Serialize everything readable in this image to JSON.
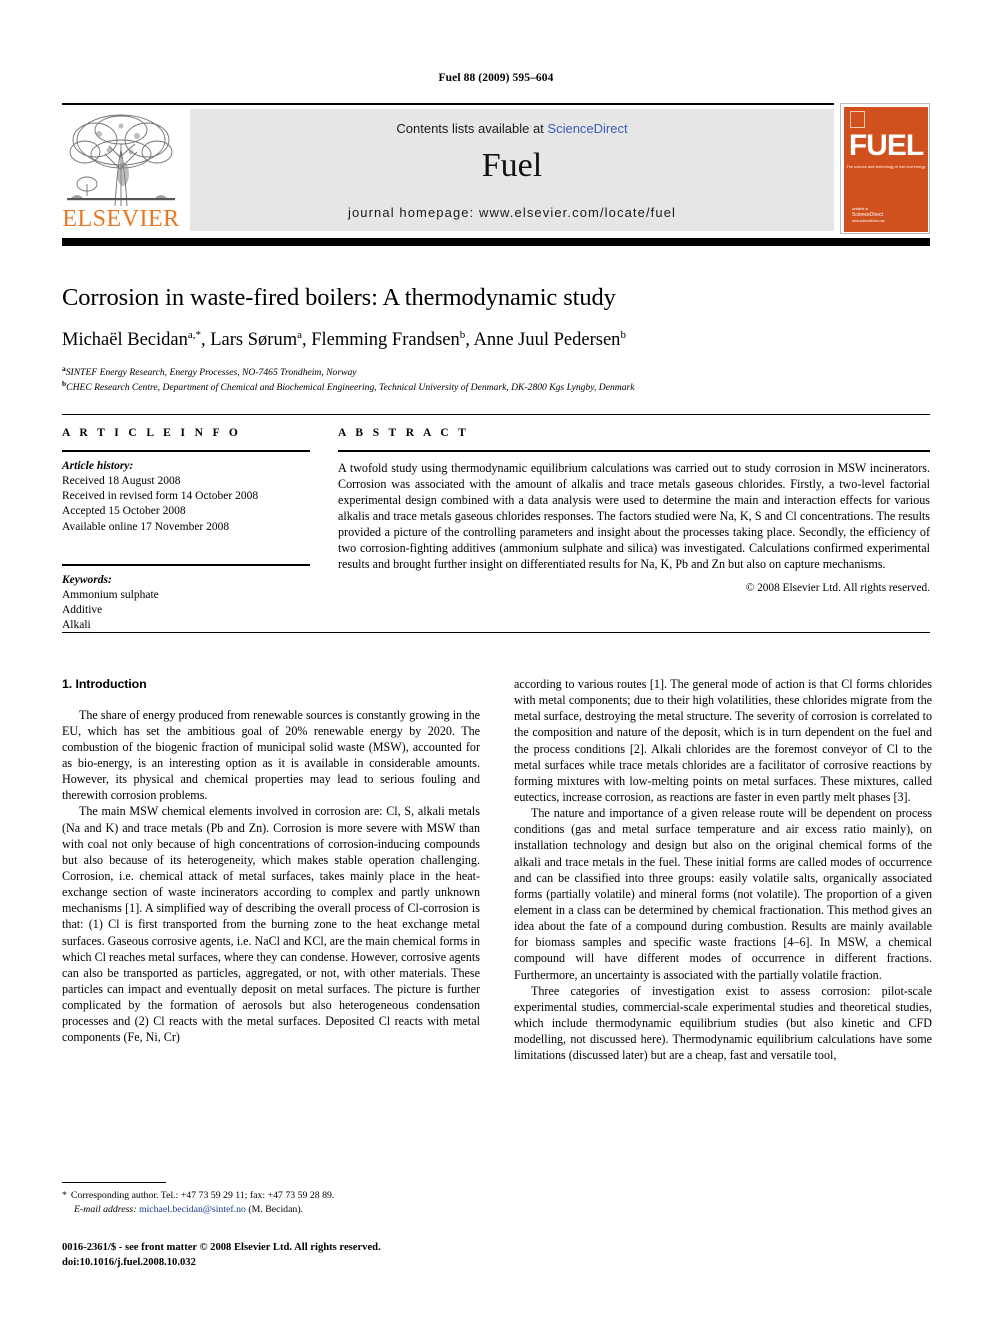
{
  "running_head": "Fuel 88 (2009) 595–604",
  "masthead": {
    "publisher": "ELSEVIER",
    "contents_prefix": "Contents lists available at ",
    "contents_link": "ScienceDirect",
    "journal_title": "Fuel",
    "homepage": "journal homepage: www.elsevier.com/locate/fuel",
    "cover": {
      "wordmark": "FUEL",
      "tagline": "The science and technology of fuel and energy",
      "sciencedirect_label": "available at",
      "sciencedirect_brand": "ScienceDirect",
      "sciencedirect_url": "www.sciencedirect.com"
    }
  },
  "article": {
    "title": "Corrosion in waste-fired boilers: A thermodynamic study",
    "authors": [
      {
        "name": "Michaël Becidan",
        "marks": "a,*"
      },
      {
        "name": "Lars Sørum",
        "marks": "a"
      },
      {
        "name": "Flemming Frandsen",
        "marks": "b"
      },
      {
        "name": "Anne Juul Pedersen",
        "marks": "b"
      }
    ],
    "affiliations": [
      {
        "mark": "a",
        "text": "SINTEF Energy Research, Energy Processes, NO-7465 Trondheim, Norway"
      },
      {
        "mark": "b",
        "text": "CHEC Research Centre, Department of Chemical and Biochemical Engineering, Technical University of Denmark, DK-2800 Kgs Lyngby, Denmark"
      }
    ]
  },
  "info": {
    "heading": "A R T I C L E    I N F O",
    "history_label": "Article history:",
    "history": [
      "Received 18 August 2008",
      "Received in revised form 14 October 2008",
      "Accepted 15 October 2008",
      "Available online 17 November 2008"
    ],
    "keywords_label": "Keywords:",
    "keywords": [
      "Ammonium sulphate",
      "Additive",
      "Alkali"
    ]
  },
  "abstract": {
    "heading": "A B S T R A C T",
    "text": "A twofold study using thermodynamic equilibrium calculations was carried out to study corrosion in MSW incinerators. Corrosion was associated with the amount of alkalis and trace metals gaseous chlorides. Firstly, a two-level factorial experimental design combined with a data analysis were used to determine the main and interaction effects for various alkalis and trace metals gaseous chlorides responses. The factors studied were Na, K, S and Cl concentrations. The results provided a picture of the controlling parameters and insight about the processes taking place. Secondly, the efficiency of two corrosion-fighting additives (ammonium sulphate and silica) was investigated. Calculations confirmed experimental results and brought further insight on differentiated results for Na, K, Pb and Zn but also on capture mechanisms.",
    "copyright": "© 2008 Elsevier Ltd. All rights reserved."
  },
  "introduction": {
    "heading": "1. Introduction",
    "left_paragraphs": [
      "The share of energy produced from renewable sources is constantly growing in the EU, which has set the ambitious goal of 20% renewable energy by 2020. The combustion of the biogenic fraction of municipal solid waste (MSW), accounted for as bio-energy, is an interesting option as it is available in considerable amounts. However, its physical and chemical properties may lead to serious fouling and therewith corrosion problems.",
      "The main MSW chemical elements involved in corrosion are: Cl, S, alkali metals (Na and K) and trace metals (Pb and Zn). Corrosion is more severe with MSW than with coal not only because of high concentrations of corrosion-inducing compounds but also because of its heterogeneity, which makes stable operation challenging. Corrosion, i.e. chemical attack of metal surfaces, takes mainly place in the heat-exchange section of waste incinerators according to complex and partly unknown mechanisms [1]. A simplified way of describing the overall process of Cl-corrosion is that: (1) Cl is first transported from the burning zone to the heat exchange metal surfaces. Gaseous corrosive agents, i.e. NaCl and KCl, are the main chemical forms in which Cl reaches metal surfaces, where they can condense. However, corrosive agents can also be transported as particles, aggregated, or not, with other materials. These particles can impact and eventually deposit on metal surfaces. The picture is further complicated by the formation of aerosols but also heterogeneous condensation processes and (2) Cl reacts with the metal surfaces. Deposited Cl reacts with metal components (Fe, Ni, Cr)"
    ],
    "right_paragraphs": [
      "according to various routes [1]. The general mode of action is that Cl forms chlorides with metal components; due to their high volatilities, these chlorides migrate from the metal surface, destroying the metal structure. The severity of corrosion is correlated to the composition and nature of the deposit, which is in turn dependent on the fuel and the process conditions [2]. Alkali chlorides are the foremost conveyor of Cl to the metal surfaces while trace metals chlorides are a facilitator of corrosive reactions by forming mixtures with low-melting points on metal surfaces. These mixtures, called eutectics, increase corrosion, as reactions are faster in even partly melt phases [3].",
      "The nature and importance of a given release route will be dependent on process conditions (gas and metal surface temperature and air excess ratio mainly), on installation technology and design but also on the original chemical forms of the alkali and trace metals in the fuel. These initial forms are called modes of occurrence and can be classified into three groups: easily volatile salts, organically associated forms (partially volatile) and mineral forms (not volatile). The proportion of a given element in a class can be determined by chemical fractionation. This method gives an idea about the fate of a compound during combustion. Results are mainly available for biomass samples and specific waste fractions [4–6]. In MSW, a chemical compound will have different modes of occurrence in different fractions. Furthermore, an uncertainty is associated with the partially volatile fraction.",
      "Three categories of investigation exist to assess corrosion: pilot-scale experimental studies, commercial-scale experimental studies and theoretical studies, which include thermodynamic equilibrium studies (but also kinetic and CFD modelling, not discussed here). Thermodynamic equilibrium calculations have some limitations (discussed later) but are a cheap, fast and versatile tool,"
    ]
  },
  "footnote": {
    "corresponding": "Corresponding author. Tel.: +47 73 59 29 11; fax: +47 73 59 28 89.",
    "email_label": "E-mail address:",
    "email": "michael.becidan@sintef.no",
    "email_suffix": "(M. Becidan)."
  },
  "imprint": {
    "line1": "0016-2361/$ - see front matter © 2008 Elsevier Ltd. All rights reserved.",
    "line2": "doi:10.1016/j.fuel.2008.10.032"
  },
  "colors": {
    "elsevier_orange": "#E87722",
    "cover_orange": "#D0501E",
    "link_blue": "#3b5bb5",
    "reference_blue": "#1a3a8f",
    "band_grey": "#e6e6e6"
  }
}
